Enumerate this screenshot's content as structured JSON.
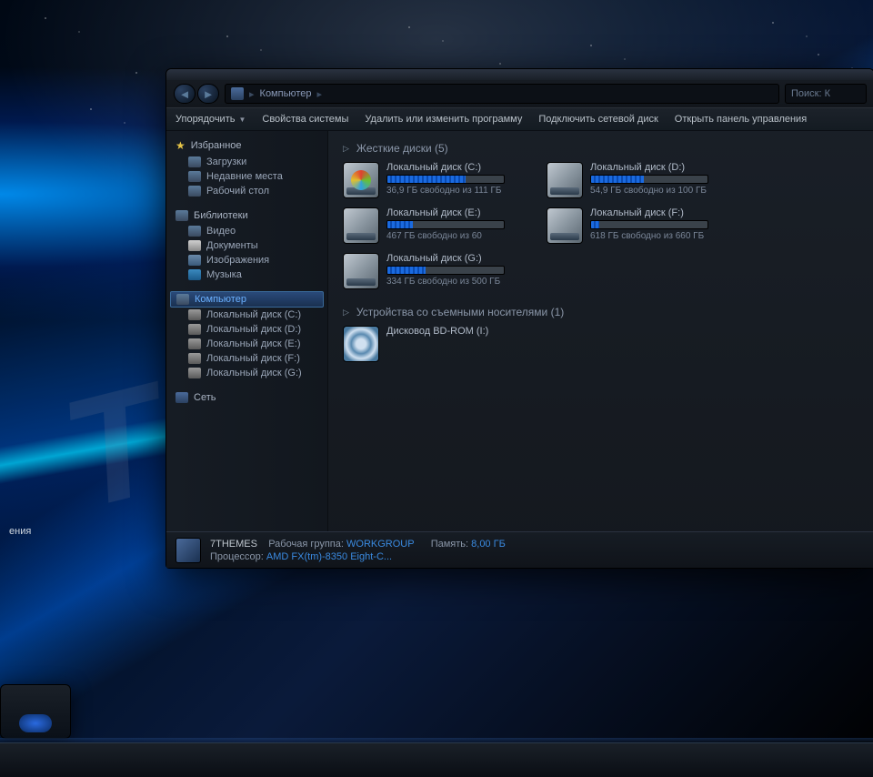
{
  "watermark": "THEMES.S",
  "desktop_label": "ения",
  "address": {
    "location": "Компьютер",
    "search_placeholder": "Поиск: К"
  },
  "toolbar": {
    "organize": "Упорядочить",
    "system_props": "Свойства системы",
    "uninstall": "Удалить или изменить программу",
    "map_drive": "Подключить сетевой диск",
    "control_panel": "Открыть панель управления"
  },
  "sidebar": {
    "favorites": {
      "header": "Избранное",
      "items": [
        "Загрузки",
        "Недавние места",
        "Рабочий стол"
      ]
    },
    "libraries": {
      "header": "Библиотеки",
      "items": [
        "Видео",
        "Документы",
        "Изображения",
        "Музыка"
      ]
    },
    "computer": {
      "header": "Компьютер",
      "items": [
        "Локальный диск (C:)",
        "Локальный диск (D:)",
        "Локальный диск (E:)",
        "Локальный диск (F:)",
        "Локальный диск (G:)"
      ]
    },
    "network": {
      "header": "Сеть"
    }
  },
  "groups": {
    "hdd": {
      "label": "Жесткие диски (5)"
    },
    "removable": {
      "label": "Устройства со съемными носителями (1)"
    }
  },
  "drives": [
    {
      "name": "Локальный диск (C:)",
      "status": "36,9 ГБ свободно из 111 ГБ",
      "fill": 67,
      "win": true
    },
    {
      "name": "Локальный диск (D:)",
      "status": "54,9 ГБ свободно из 100 ГБ",
      "fill": 45
    },
    {
      "name": "Локальный диск (E:)",
      "status": "467 ГБ свободно из 60",
      "fill": 22
    },
    {
      "name": "Локальный диск (F:)",
      "status": "618 ГБ свободно из 660 ГБ",
      "fill": 7
    },
    {
      "name": "Локальный диск (G:)",
      "status": "334 ГБ свободно из 500 ГБ",
      "fill": 33
    }
  ],
  "removable": [
    {
      "name": "Дисковод BD-ROM (I:)"
    }
  ],
  "details": {
    "name": "7THEMES",
    "workgroup_label": "Рабочая группа:",
    "workgroup": "WORKGROUP",
    "memory_label": "Память:",
    "memory": "8,00 ГБ",
    "cpu_label": "Процессор:",
    "cpu": "AMD FX(tm)-8350 Eight-C..."
  }
}
